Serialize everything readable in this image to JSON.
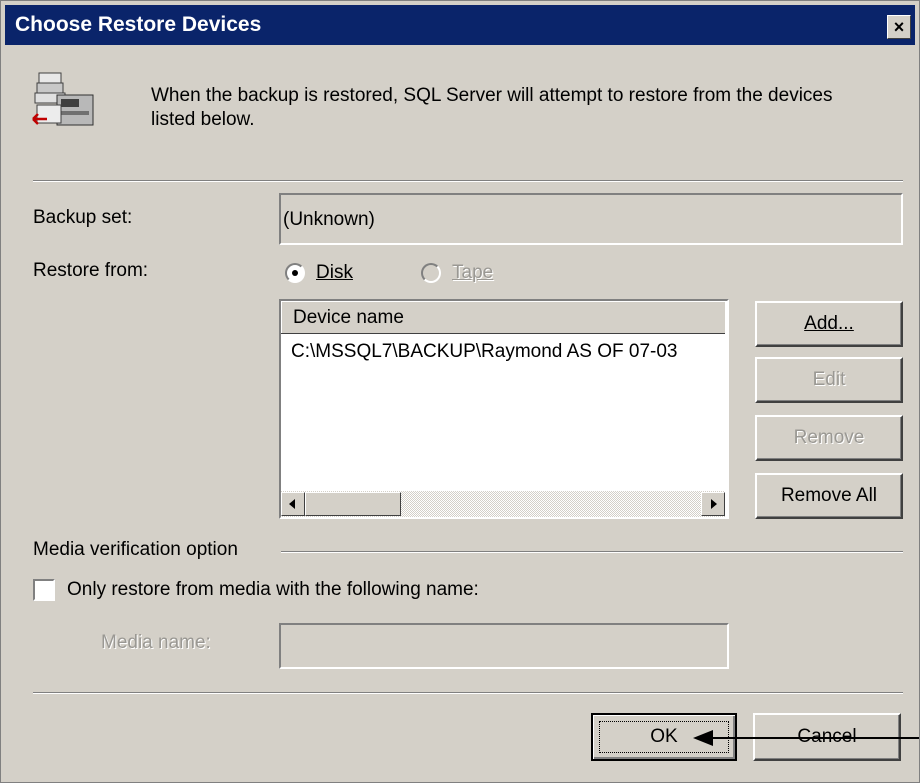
{
  "window": {
    "title": "Choose Restore Devices",
    "close_glyph": "×"
  },
  "header": {
    "icon": "tape-drive-restore-icon",
    "message": "When the backup is restored, SQL Server will attempt to restore from the devices listed below."
  },
  "backup_set": {
    "label": "Backup set:",
    "value": "(Unknown)"
  },
  "restore_from": {
    "label": "Restore from:",
    "disk_label": "Disk",
    "disk_selected": true,
    "tape_label": "Tape",
    "tape_enabled": false
  },
  "devices": {
    "column_header": "Device name",
    "rows": [
      "C:\\MSSQL7\\BACKUP\\Raymond AS OF 07-03"
    ]
  },
  "device_buttons": {
    "add": "Add...",
    "edit": "Edit",
    "remove": "Remove",
    "remove_all": "Remove All"
  },
  "media_verification": {
    "group_label": "Media verification option",
    "checkbox_label": "Only restore from media with the following name:",
    "checked": false,
    "media_name_label": "Media name:",
    "media_name_value": ""
  },
  "footer": {
    "ok": "OK",
    "cancel": "Cancel"
  }
}
